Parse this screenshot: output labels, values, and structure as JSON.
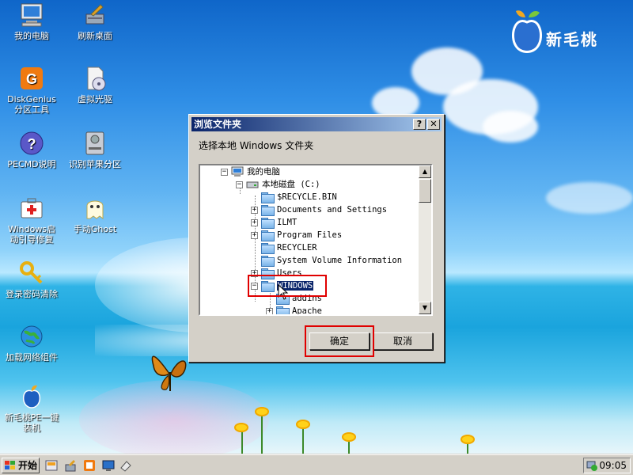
{
  "desktop": {
    "icons": [
      {
        "label": "我的电脑"
      },
      {
        "label": "刷新桌面"
      },
      {
        "label": "DiskGenius分区工具"
      },
      {
        "label": "虚拟光驱"
      },
      {
        "label": "PECMD说明"
      },
      {
        "label": "识别苹果分区"
      },
      {
        "label": "Windows启动引导修复"
      },
      {
        "label": "手动Ghost"
      },
      {
        "label": "登录密码清除"
      },
      {
        "label": "加载网络组件"
      },
      {
        "label": "新毛桃PE一键装机"
      }
    ],
    "logo_text": "新毛桃"
  },
  "dialog": {
    "title": "浏览文件夹",
    "help_button": "?",
    "close_button": "✕",
    "prompt": "选择本地 Windows 文件夹",
    "tree": [
      {
        "label": "我的电脑",
        "expander": "−"
      },
      {
        "label": "本地磁盘 (C:)",
        "expander": "−"
      },
      {
        "label": "$RECYCLE.BIN",
        "expander": ""
      },
      {
        "label": "Documents and Settings",
        "expander": "+"
      },
      {
        "label": "ILMT",
        "expander": "+"
      },
      {
        "label": "Program Files",
        "expander": "+"
      },
      {
        "label": "RECYCLER",
        "expander": ""
      },
      {
        "label": "System Volume Information",
        "expander": ""
      },
      {
        "label": "Users",
        "expander": "+"
      },
      {
        "label": "WINDOWS",
        "expander": "−",
        "selected": true
      },
      {
        "label": "addins",
        "expander": ""
      },
      {
        "label": "Apache",
        "expander": "+"
      }
    ],
    "ok_button": "确定",
    "cancel_button": "取消"
  },
  "taskbar": {
    "start_label": "开始",
    "clock": "09:05"
  },
  "colors": {
    "titlebar": "#0a246a",
    "highlight": "#e00000",
    "face": "#d4d0c8"
  }
}
